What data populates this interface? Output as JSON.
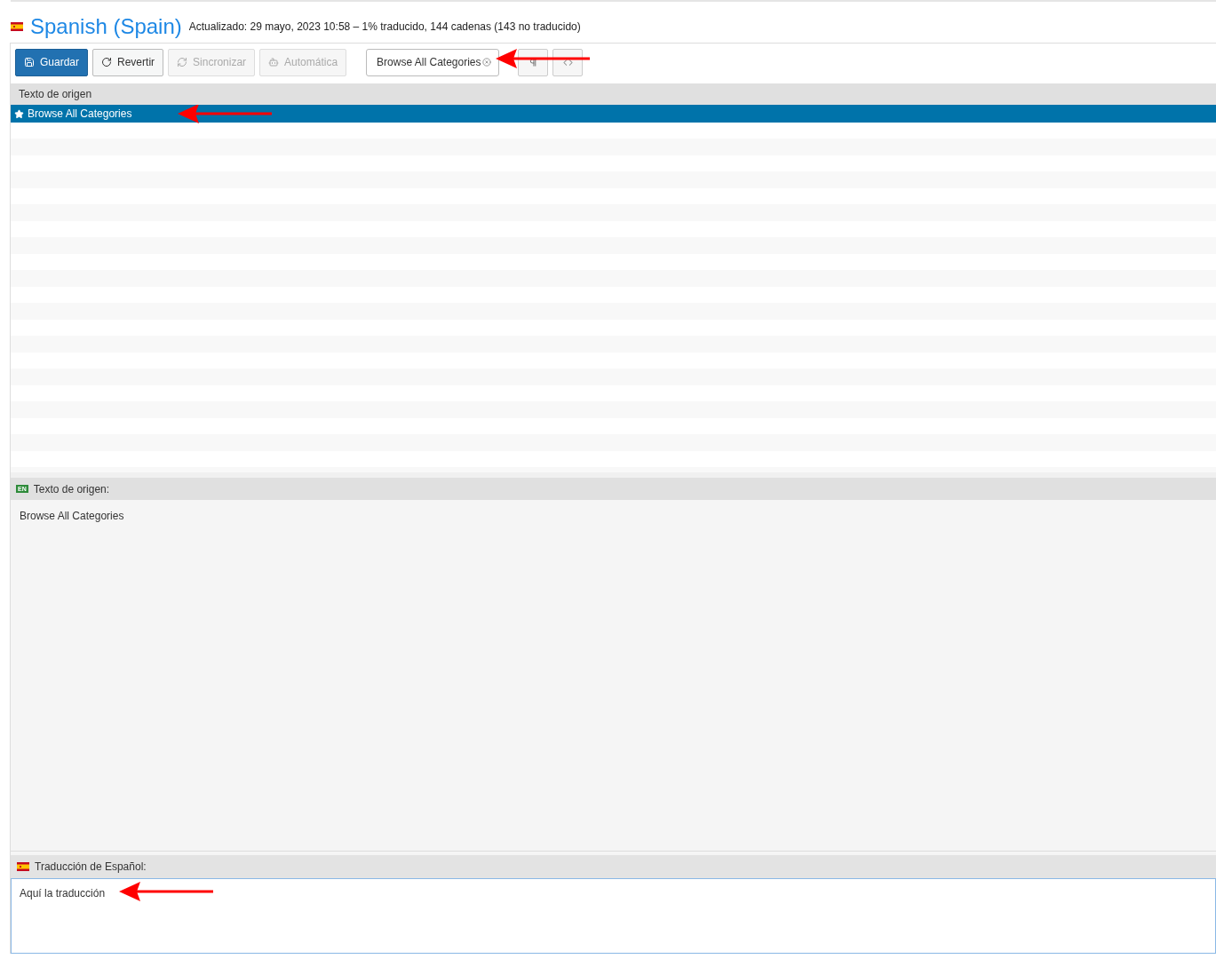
{
  "header": {
    "title": "Spanish (Spain)",
    "status": "Actualizado: 29 mayo, 2023 10:58 – 1% traducido, 144 cadenas (143 no traducido)"
  },
  "toolbar": {
    "buttons": [
      {
        "label": "Guardar",
        "kind": "save",
        "disabled": false,
        "primary": true
      },
      {
        "label": "Revertir",
        "kind": "revert",
        "disabled": false,
        "primary": false
      },
      {
        "label": "Sincronizar",
        "kind": "sync",
        "disabled": true,
        "primary": false
      },
      {
        "label": "Automática",
        "kind": "robot",
        "disabled": true,
        "primary": false
      }
    ],
    "filter": {
      "value": "Browse All Categories"
    }
  },
  "list": {
    "column": "Texto de origen",
    "rows": [
      {
        "text": "Browse All Categories",
        "starred": true,
        "selected": true
      }
    ]
  },
  "source_panel": {
    "badge": "EN",
    "label": "Texto de origen:",
    "text": "Browse All Categories"
  },
  "translation_panel": {
    "label": "Traducción de Español:",
    "value": "Aquí la traducción"
  }
}
